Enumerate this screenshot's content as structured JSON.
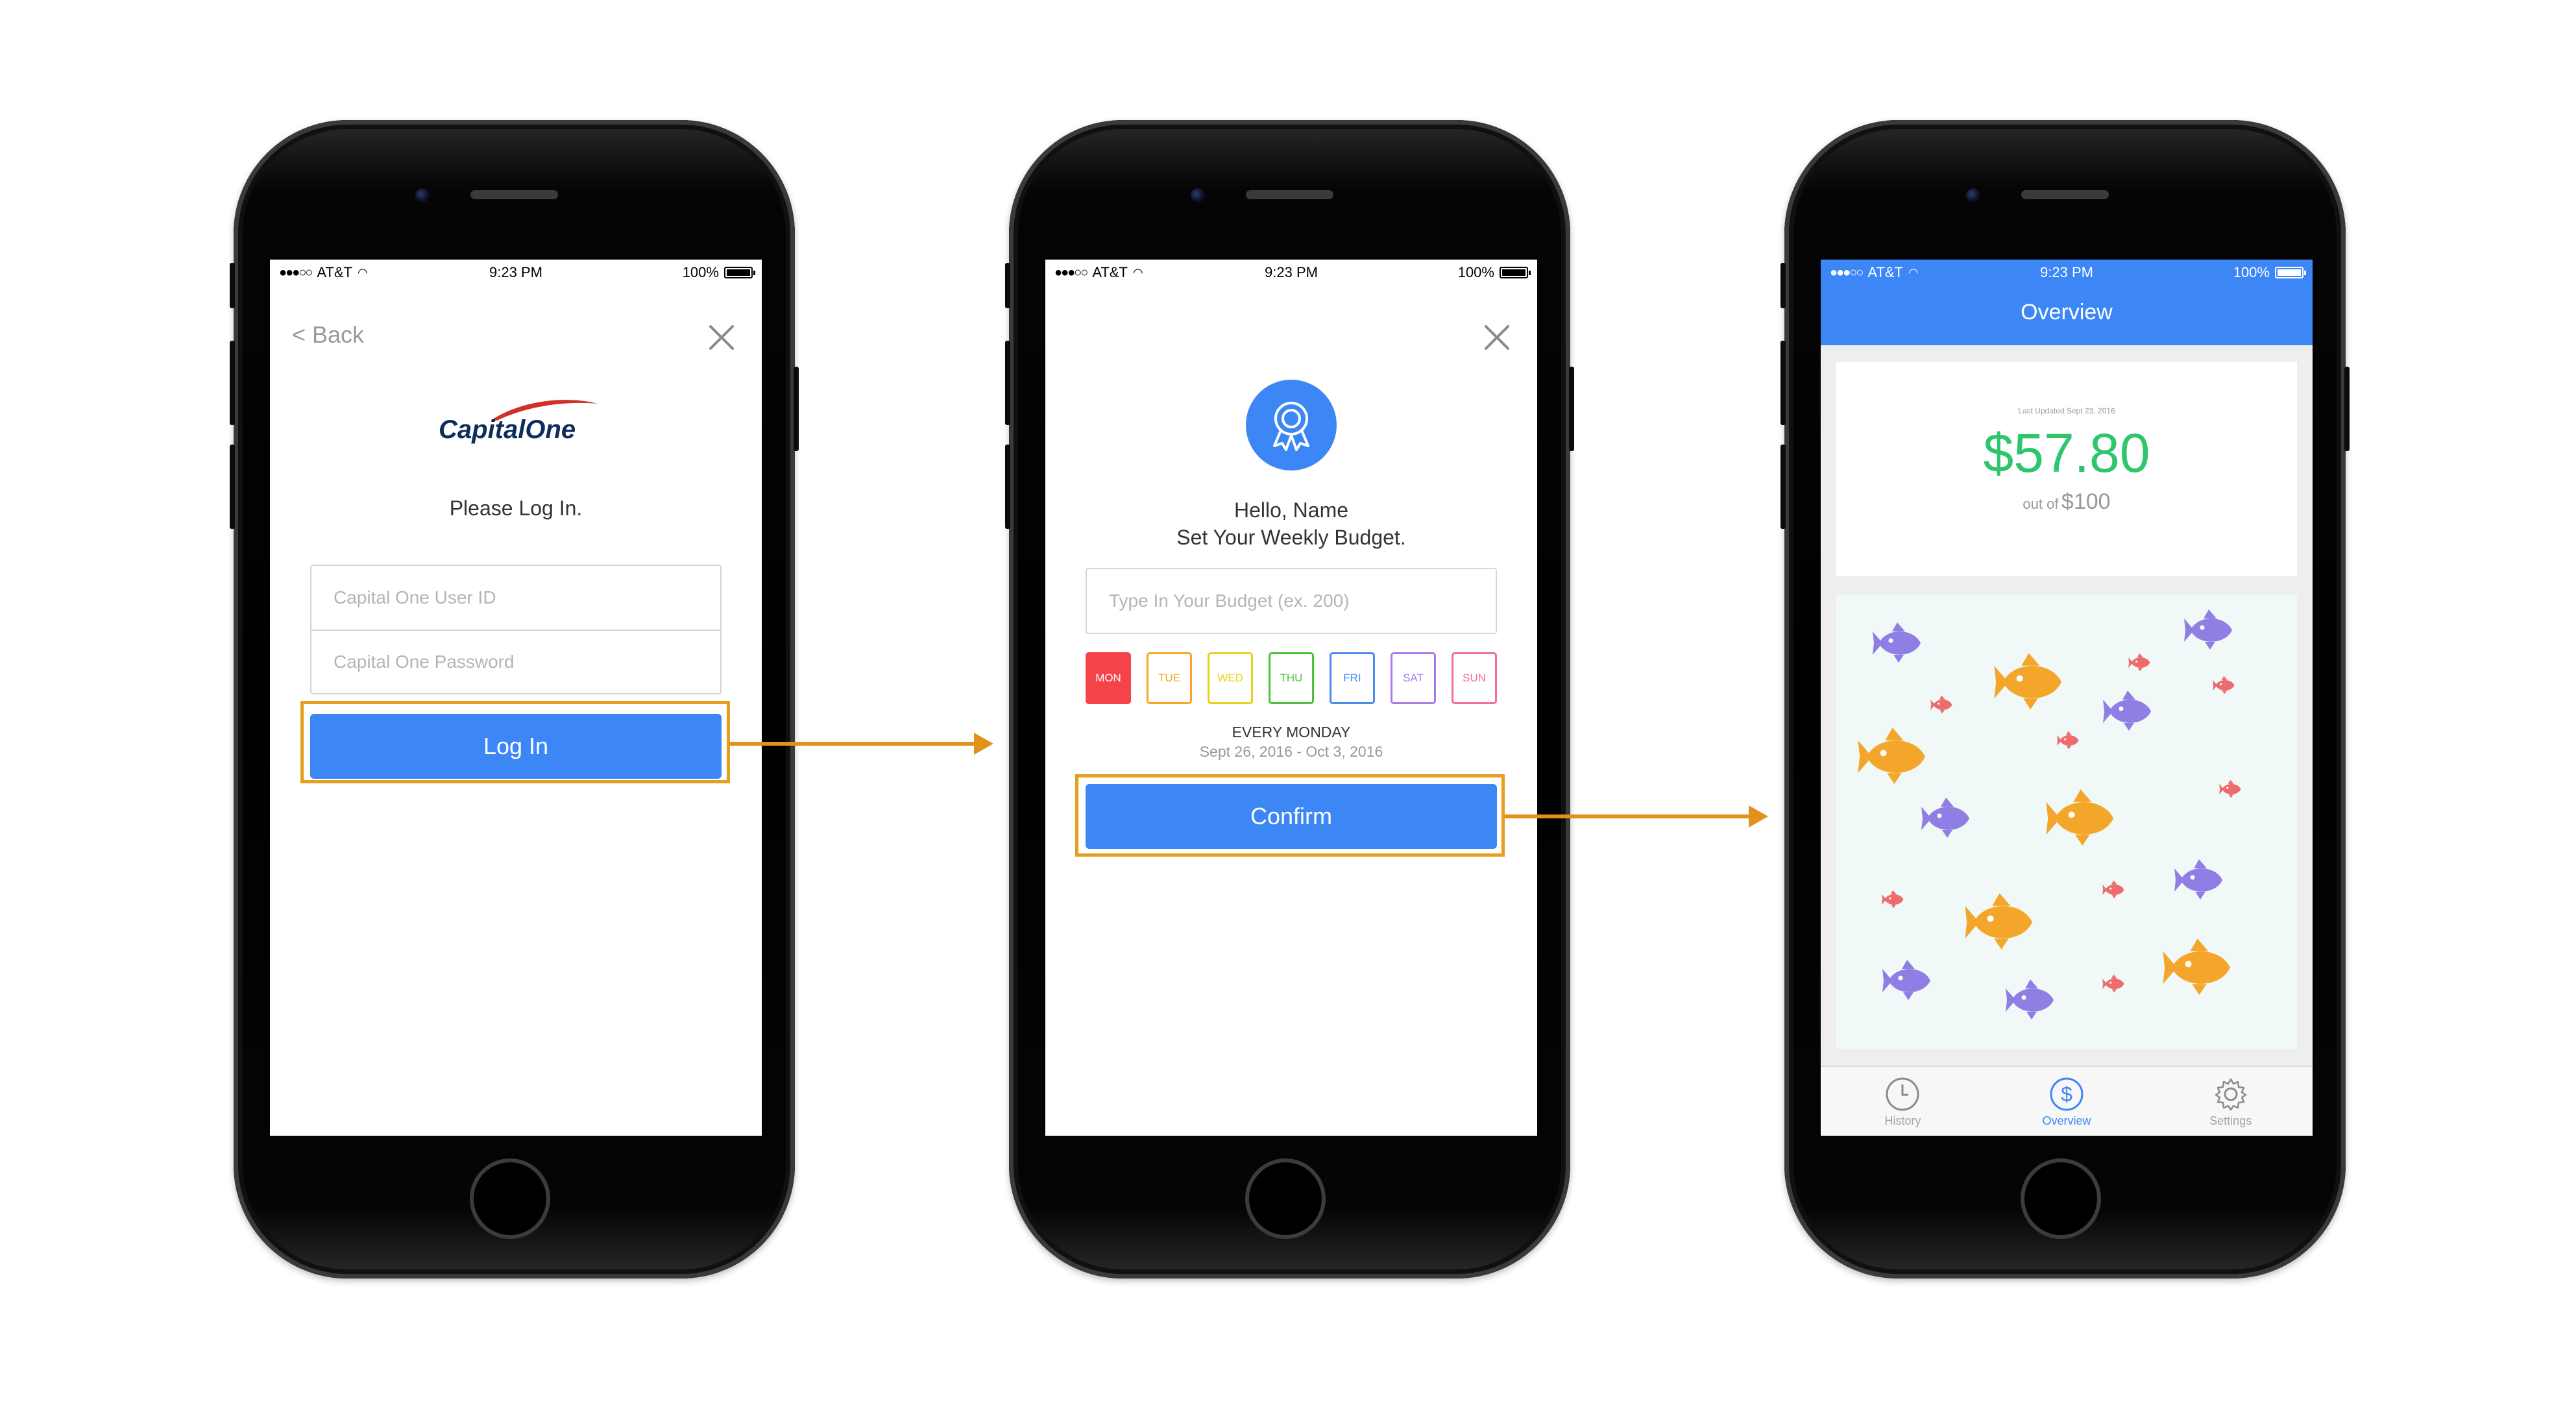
{
  "colors": {
    "accent": "#3d86f6",
    "highlight": "#e59f1c",
    "arrow": "#e0921a",
    "amount_green": "#2ec66c",
    "fish_orange": "#f4a62a",
    "fish_purple": "#8f7fe4",
    "fish_red": "#ee6b6b"
  },
  "status_bar": {
    "carrier": "AT&T",
    "time": "9:23 PM",
    "battery": "100%"
  },
  "login_screen": {
    "back_label": "< Back",
    "logo_text": "CapitalOne",
    "prompt": "Please Log In.",
    "user_id_placeholder": "Capital One User ID",
    "password_placeholder": "Capital One Password",
    "login_button": "Log In"
  },
  "budget_screen": {
    "greeting": "Hello, Name",
    "subtitle": "Set Your Weekly Budget.",
    "budget_placeholder": "Type In Your Budget (ex. 200)",
    "days": [
      {
        "label": "MON",
        "color": "#f5434a",
        "selected": true
      },
      {
        "label": "TUE",
        "color": "#f5a623",
        "selected": false
      },
      {
        "label": "WED",
        "color": "#e8d219",
        "selected": false
      },
      {
        "label": "THU",
        "color": "#4cc13a",
        "selected": false
      },
      {
        "label": "FRI",
        "color": "#4a8af4",
        "selected": false
      },
      {
        "label": "SAT",
        "color": "#a77be8",
        "selected": false
      },
      {
        "label": "SUN",
        "color": "#f26d9a",
        "selected": false
      }
    ],
    "schedule": "EVERY MONDAY",
    "date_range": "Sept 26, 2016 - Oct 3, 2016",
    "confirm_button": "Confirm"
  },
  "overview_screen": {
    "title": "Overview",
    "last_updated": "Last Updated Sept 23, 2016",
    "amount": "$57.80",
    "out_of_label": "out of",
    "budget_total": "$100",
    "tabs": [
      {
        "label": "History",
        "icon": "clock-icon",
        "active": false
      },
      {
        "label": "Overview",
        "icon": "dollar-circle-icon",
        "active": true
      },
      {
        "label": "Settings",
        "icon": "gear-icon",
        "active": false
      }
    ]
  }
}
